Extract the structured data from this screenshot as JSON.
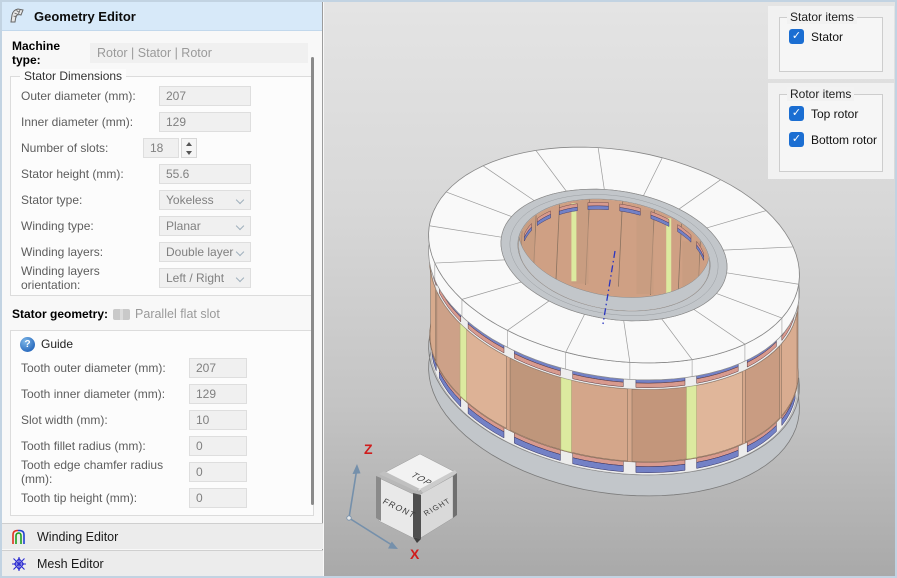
{
  "left_panel": {
    "header": {
      "title": "Geometry Editor"
    },
    "machine_type": {
      "label": "Machine type:",
      "value": "Rotor | Stator | Rotor"
    },
    "stator_dimensions": {
      "legend": "Stator Dimensions",
      "fields": [
        {
          "name": "outer-diameter",
          "label": "Outer diameter (mm):",
          "value": "207",
          "type": "text"
        },
        {
          "name": "inner-diameter",
          "label": "Inner diameter (mm):",
          "value": "129",
          "type": "text"
        },
        {
          "name": "number-of-slots",
          "label": "Number of slots:",
          "value": "18",
          "type": "spinner"
        },
        {
          "name": "stator-height",
          "label": "Stator height (mm):",
          "value": "55.6",
          "type": "text"
        },
        {
          "name": "stator-type",
          "label": "Stator type:",
          "value": "Yokeless",
          "type": "select"
        },
        {
          "name": "winding-type",
          "label": "Winding type:",
          "value": "Planar",
          "type": "select"
        },
        {
          "name": "winding-layers",
          "label": "Winding layers:",
          "value": "Double layer",
          "type": "select"
        },
        {
          "name": "winding-layers-orientation",
          "label": "Winding layers orientation:",
          "value": "Left / Right",
          "type": "select"
        }
      ]
    },
    "stator_geometry": {
      "label": "Stator geometry:",
      "value": "Parallel flat slot"
    },
    "guide": {
      "label": "Guide",
      "icon_glyph": "?"
    },
    "tooth_fields": [
      {
        "name": "tooth-outer-diameter",
        "label": "Tooth outer diameter (mm):",
        "value": "207",
        "type": "text"
      },
      {
        "name": "tooth-inner-diameter",
        "label": "Tooth inner diameter (mm):",
        "value": "129",
        "type": "text"
      },
      {
        "name": "slot-width",
        "label": "Slot width (mm):",
        "value": "10",
        "type": "text"
      },
      {
        "name": "tooth-fillet-radius",
        "label": "Tooth fillet radius (mm):",
        "value": "0",
        "type": "text"
      },
      {
        "name": "tooth-edge-chamfer-radius",
        "label": "Tooth edge chamfer radius (mm):",
        "value": "0",
        "type": "text"
      },
      {
        "name": "tooth-tip-height",
        "label": "Tooth tip height (mm):",
        "value": "0",
        "type": "text"
      }
    ],
    "bottom_sections": [
      {
        "label": "Winding Editor"
      },
      {
        "label": "Mesh Editor"
      }
    ]
  },
  "right_panel": {
    "stator_items": {
      "legend": "Stator items",
      "checkboxes": [
        {
          "name": "stator",
          "label": "Stator",
          "checked": true
        }
      ]
    },
    "rotor_items": {
      "legend": "Rotor items",
      "checkboxes": [
        {
          "name": "top-rotor",
          "label": "Top rotor",
          "checked": true
        },
        {
          "name": "bottom-rotor",
          "label": "Bottom rotor",
          "checked": true
        }
      ]
    },
    "icons": {
      "checkbox_check": "✓"
    }
  },
  "viewport": {
    "cube": {
      "top": "TOP",
      "front": "FRONT",
      "right": "RIGHT"
    },
    "axes": {
      "z": "Z",
      "x": "X"
    },
    "model": {
      "segments": 18,
      "colors": {
        "rotor_white": "#f9f9f9",
        "rim_gray": "#c2c6ca",
        "copper_base": "#d5a78b",
        "copper_shades": [
          "#d9ac90",
          "#c99c82",
          "#e0b69a",
          "#c3967b",
          "#d4a68a",
          "#bf967b",
          "#ddb296",
          "#cda188",
          "#d7aa8d"
        ],
        "green_strip": "#dcea9f",
        "wedge_blue": "#7381c6",
        "wedge_salmon": "#d89a8e",
        "outline": "#7a7a7a",
        "centerline_blue": "#2a35c0",
        "axis_red": "#cf1d1d",
        "arrow_gray": "#7590ab"
      }
    }
  }
}
